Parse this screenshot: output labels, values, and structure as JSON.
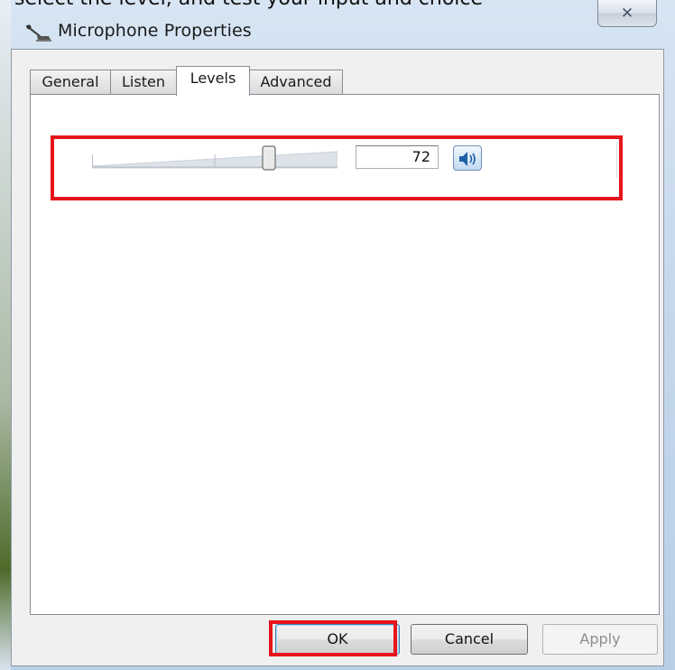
{
  "page_caption_clip": "select the level, and test your input and choice",
  "window": {
    "title": "Microphone Properties",
    "close_glyph": "✕"
  },
  "tabs": [
    {
      "label": "General",
      "active": false
    },
    {
      "label": "Listen",
      "active": false
    },
    {
      "label": "Levels",
      "active": true
    },
    {
      "label": "Advanced",
      "active": false
    }
  ],
  "levels": {
    "value": "72",
    "slider_fraction": 0.72,
    "speaker_icon": "speaker-icon"
  },
  "buttons": {
    "ok": "OK",
    "cancel": "Cancel",
    "apply": "Apply"
  },
  "colors": {
    "highlight": "#e8141c",
    "accent": "#3c7fb1"
  }
}
